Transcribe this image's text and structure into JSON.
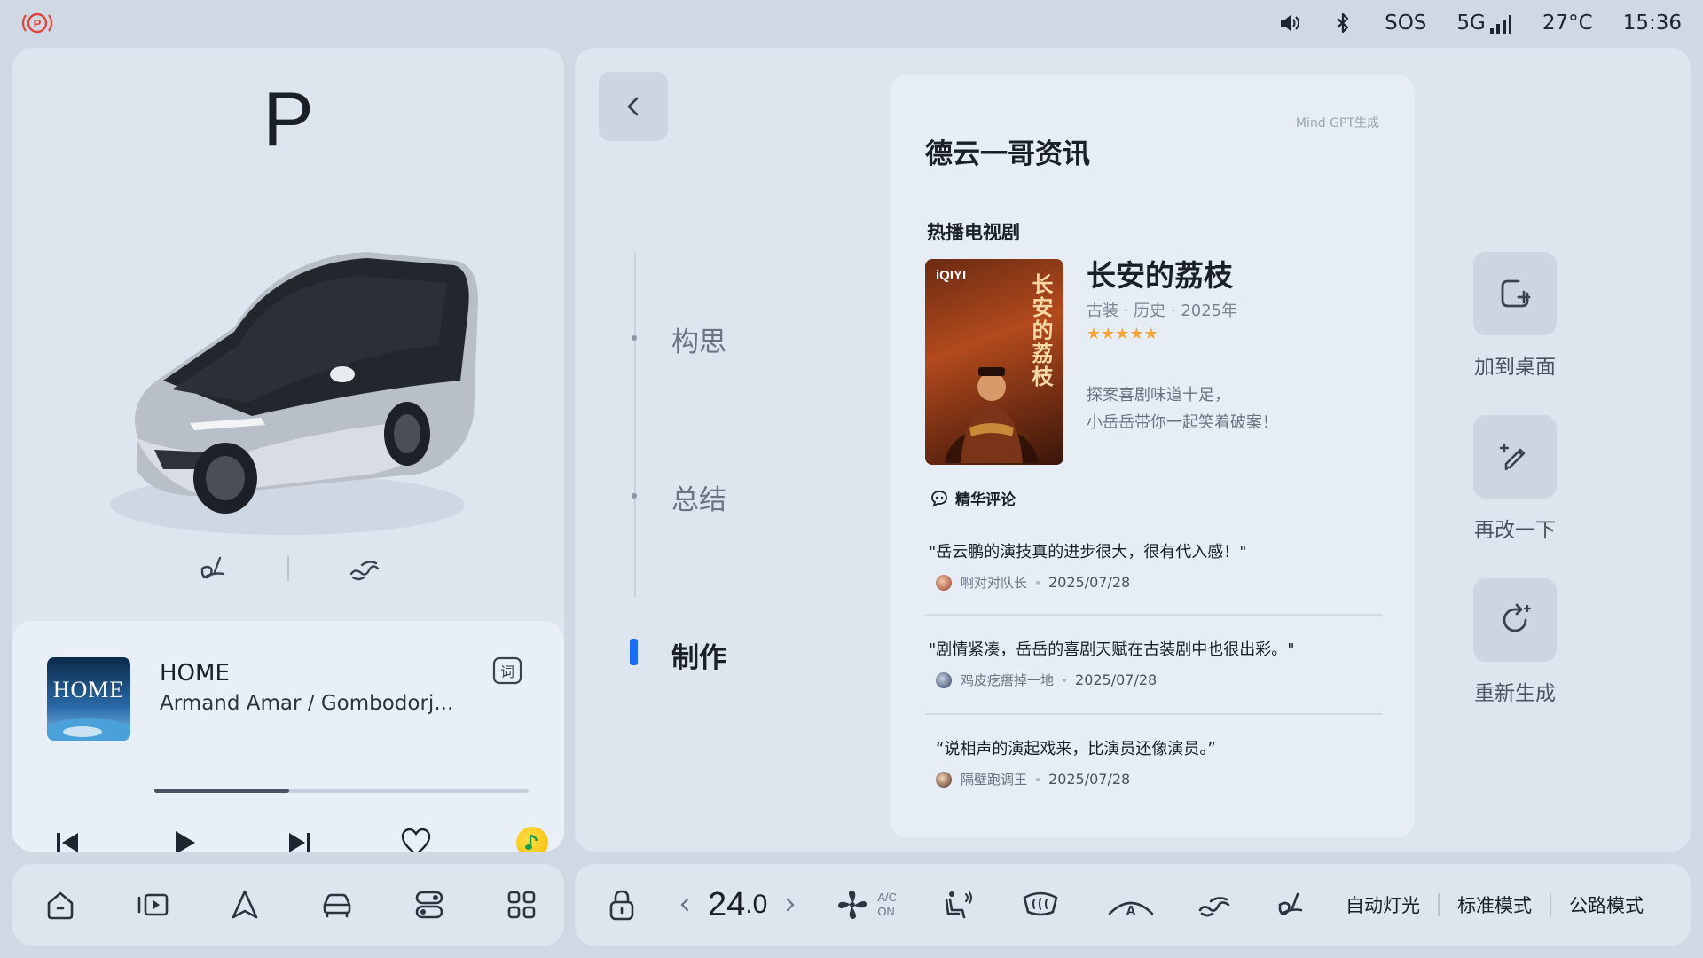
{
  "status_bar": {
    "parking_icon": "parking-brake-icon",
    "sos": "SOS",
    "network": "5G",
    "temperature": "27°C",
    "time": "15:36",
    "icons": [
      "volume-icon",
      "bluetooth-icon",
      "signal-icon"
    ]
  },
  "vehicle": {
    "gear": "P",
    "seat_icons": [
      "driver-seat-heat-icon",
      "passenger-seat-heat-icon"
    ]
  },
  "music": {
    "album_text": "HOME",
    "title": "HOME",
    "artist": "Armand Amar / Gombodorj...",
    "progress": 0.36,
    "lyrics_icon": "lyrics-icon",
    "controls": [
      "previous-icon",
      "play-icon",
      "next-icon",
      "heart-icon",
      "qq-music-icon"
    ]
  },
  "steps": {
    "items": [
      {
        "label": "构思",
        "active": false
      },
      {
        "label": "总结",
        "active": false
      },
      {
        "label": "制作",
        "active": true
      }
    ]
  },
  "card": {
    "generated_by": "Mind GPT生成",
    "title": "德云一哥资讯",
    "section": "热播电视剧",
    "show": {
      "poster_logo": "iQIYI",
      "poster_title": "长安的荔枝",
      "title": "长安的荔枝",
      "meta": "古装 · 历史 · 2025年",
      "rating": 5,
      "stars": "★★★★★",
      "desc_line1": "探案喜剧味道十足，",
      "desc_line2": "小岳岳带你一起笑着破案！"
    },
    "comments_header": "精华评论",
    "comments": [
      {
        "text": "\"岳云鹏的演技真的进步很大，很有代入感！\"",
        "user": "啊对对队长",
        "date": "2025/07/28"
      },
      {
        "text": "\"剧情紧凑，岳岳的喜剧天赋在古装剧中也很出彩。\"",
        "user": "鸡皮疙瘩掉一地",
        "date": "2025/07/28"
      },
      {
        "text": "“说相声的演起戏来，比演员还像演员。”",
        "user": "隔壁跑调王",
        "date": "2025/07/28"
      }
    ]
  },
  "actions": [
    {
      "label": "加到桌面",
      "icon": "add-to-desktop-icon"
    },
    {
      "label": "再改一下",
      "icon": "edit-sparkle-icon"
    },
    {
      "label": "重新生成",
      "icon": "regenerate-icon"
    }
  ],
  "dock": {
    "left_icons": [
      "home-icon",
      "media-icon",
      "navigation-icon",
      "car-icon",
      "toggle-settings-icon",
      "apps-grid-icon"
    ],
    "temperature_int": "24",
    "temperature_dec": ".0",
    "ac_top": "A/C",
    "ac_bottom": "ON",
    "climate_icons": [
      "lock-icon",
      "fan-icon",
      "seat-airflow-icon",
      "rear-defrost-icon",
      "front-defrost-icon",
      "passenger-seat-icon",
      "driver-seat-icon"
    ],
    "modes": [
      "自动灯光",
      "标准模式",
      "公路模式"
    ]
  },
  "colors": {
    "accent": "#1a6cf2",
    "background": "#cfd8e3",
    "panel": "#dde5ee",
    "star": "#f2a33a"
  }
}
